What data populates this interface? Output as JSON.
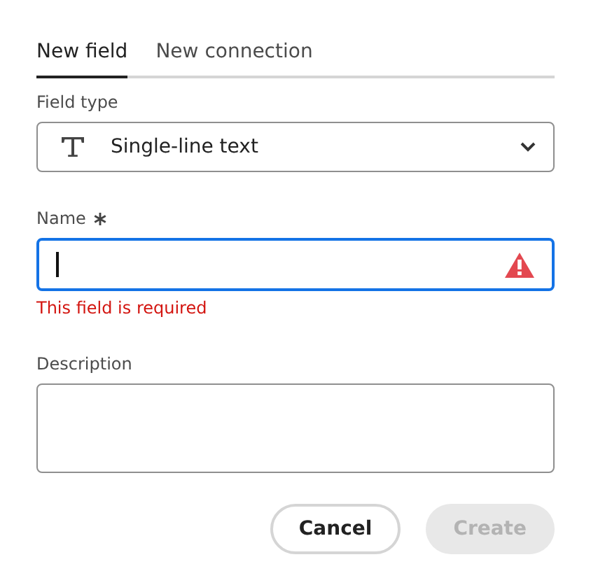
{
  "tabs": [
    {
      "label": "New field",
      "selected": true
    },
    {
      "label": "New connection",
      "selected": false
    }
  ],
  "field_type": {
    "label": "Field type",
    "value": "Single-line text"
  },
  "name": {
    "label": "Name",
    "required": true,
    "focused": true,
    "invalid": true,
    "error": "This field is required"
  },
  "description": {
    "label": "Description"
  },
  "buttons": [
    {
      "label": "Cancel",
      "kind": "secondary",
      "disabled": false
    },
    {
      "label": "Create",
      "kind": "primary",
      "disabled": true
    }
  ]
}
